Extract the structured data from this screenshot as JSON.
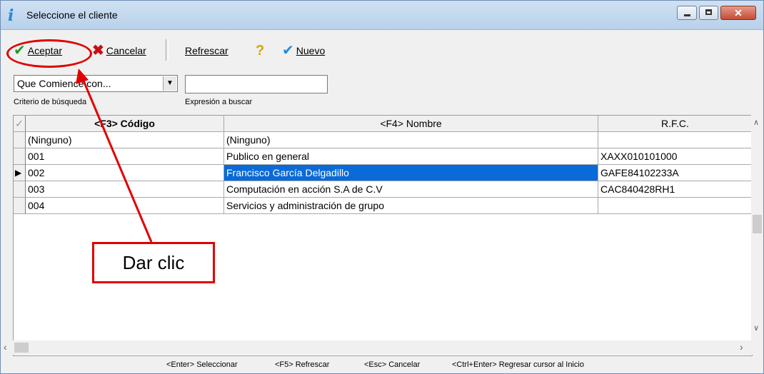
{
  "window": {
    "title": "Seleccione el cliente",
    "controls": {
      "close_glyph": "✕"
    }
  },
  "toolbar": {
    "accept_label": "Aceptar",
    "cancel_label": "Cancelar",
    "refresh_label": "Refrescar",
    "help_icon_glyph": "?",
    "new_label": "Nuevo"
  },
  "search": {
    "criteria_value": "Que Comience con...",
    "criteria_label": "Criterio de búsqueda",
    "expression_label": "Expresión a buscar",
    "expression_value": ""
  },
  "grid": {
    "columns": [
      "<F3> Código",
      "<F4> Nombre",
      "R.F.C."
    ],
    "rows": [
      {
        "codigo": "(Ninguno)",
        "nombre": "(Ninguno)",
        "rfc": ""
      },
      {
        "codigo": "001",
        "nombre": "Publico en general",
        "rfc": "XAXX010101000"
      },
      {
        "codigo": "002",
        "nombre": "Francisco  García Delgadillo",
        "rfc": "GAFE84102233A"
      },
      {
        "codigo": "003",
        "nombre": "Computación en acción S.A de C.V",
        "rfc": "CAC840428RH1"
      },
      {
        "codigo": "004",
        "nombre": "Servicios y administración de grupo",
        "rfc": ""
      }
    ],
    "current_row_marker": "▶"
  },
  "statusbar": {
    "hint1": "<Enter> Seleccionar",
    "hint2": "<F5> Refrescar",
    "hint3": "<Esc> Cancelar",
    "hint4": "<Ctrl+Enter> Regresar cursor al Inicio"
  },
  "annotation": {
    "callout_text": "Dar clic",
    "color": "#e00000"
  },
  "colors": {
    "selection": "#0a6ad8",
    "accept_check": "#1f9a1f",
    "cancel_x": "#c81010",
    "new_check": "#2a8ad8"
  }
}
